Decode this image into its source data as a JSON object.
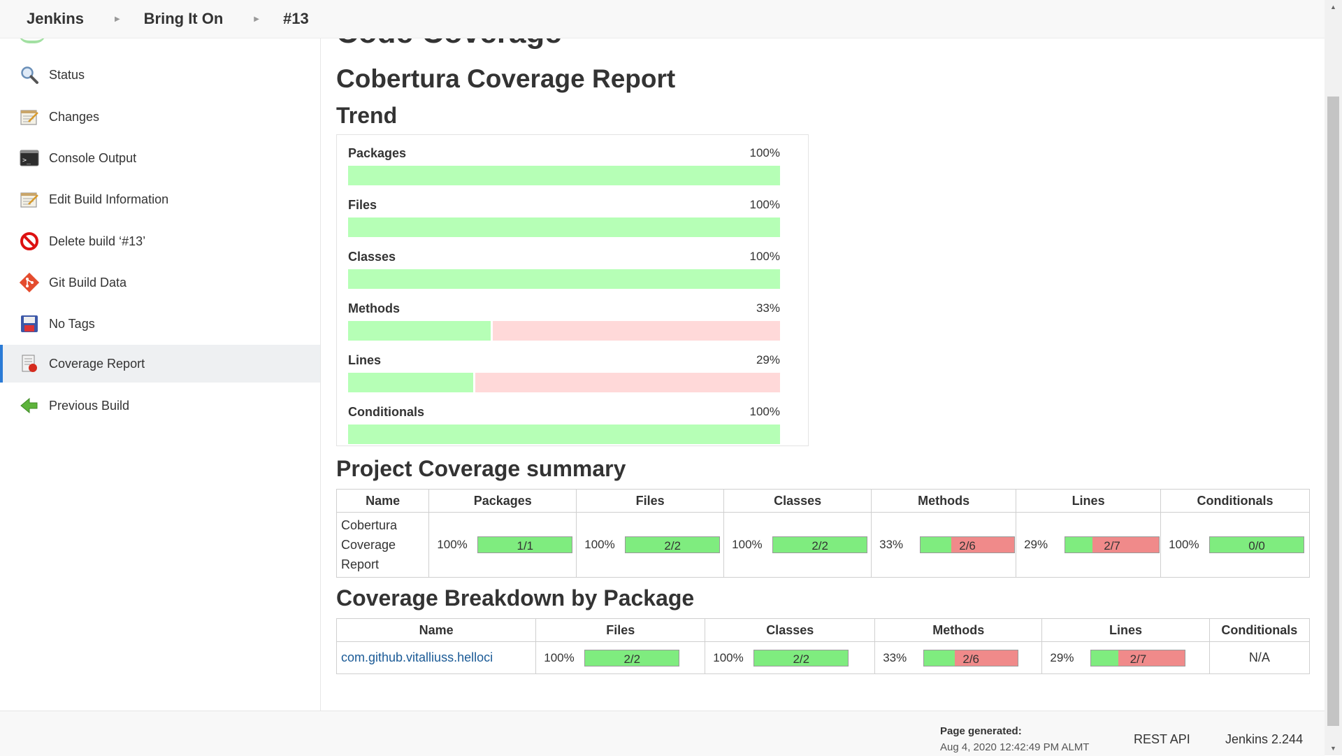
{
  "breadcrumb": [
    "Jenkins",
    "Bring It On",
    "#13"
  ],
  "sidebar": {
    "items": [
      {
        "label": "Status",
        "icon": "magnifier-icon"
      },
      {
        "label": "Changes",
        "icon": "notepad-icon"
      },
      {
        "label": "Console Output",
        "icon": "terminal-icon"
      },
      {
        "label": "Edit Build Information",
        "icon": "notepad-icon"
      },
      {
        "label": "Delete build ‘#13’",
        "icon": "no-entry-icon"
      },
      {
        "label": "Git Build Data",
        "icon": "git-icon"
      },
      {
        "label": "No Tags",
        "icon": "save-icon"
      },
      {
        "label": "Coverage Report",
        "icon": "coverage-report-icon",
        "active": true
      },
      {
        "label": "Previous Build",
        "icon": "arrow-left-icon"
      }
    ]
  },
  "main": {
    "cut_heading": "Code Coverage",
    "report_title": "Cobertura Coverage Report",
    "trend_heading": "Trend",
    "summary_heading": "Project Coverage summary",
    "breakdown_heading": "Coverage Breakdown by Package"
  },
  "trend": [
    {
      "name": "Packages",
      "pct": "100%",
      "value": 100
    },
    {
      "name": "Files",
      "pct": "100%",
      "value": 100
    },
    {
      "name": "Classes",
      "pct": "100%",
      "value": 100
    },
    {
      "name": "Methods",
      "pct": "33%",
      "value": 33
    },
    {
      "name": "Lines",
      "pct": "29%",
      "value": 29
    },
    {
      "name": "Conditionals",
      "pct": "100%",
      "value": 100
    }
  ],
  "summary": {
    "headers": [
      "Name",
      "Packages",
      "Files",
      "Classes",
      "Methods",
      "Lines",
      "Conditionals"
    ],
    "row": {
      "name": "Cobertura Coverage Report",
      "cells": [
        {
          "pct": "100%",
          "ratio": "1/1",
          "value": 100
        },
        {
          "pct": "100%",
          "ratio": "2/2",
          "value": 100
        },
        {
          "pct": "100%",
          "ratio": "2/2",
          "value": 100
        },
        {
          "pct": "33%",
          "ratio": "2/6",
          "value": 33
        },
        {
          "pct": "29%",
          "ratio": "2/7",
          "value": 29
        },
        {
          "pct": "100%",
          "ratio": "0/0",
          "value": 100
        }
      ]
    }
  },
  "breakdown": {
    "headers": [
      "Name",
      "Files",
      "Classes",
      "Methods",
      "Lines",
      "Conditionals"
    ],
    "row": {
      "name": "com.github.vitalliuss.helloci",
      "cells": [
        {
          "pct": "100%",
          "ratio": "2/2",
          "value": 100
        },
        {
          "pct": "100%",
          "ratio": "2/2",
          "value": 100
        },
        {
          "pct": "33%",
          "ratio": "2/6",
          "value": 33
        },
        {
          "pct": "29%",
          "ratio": "2/7",
          "value": 29
        }
      ],
      "conditionals": "N/A"
    }
  },
  "footer": {
    "page_generated_label": "Page generated:",
    "page_generated_value": "Aug 4, 2020 12:42:49 PM ALMT",
    "rest_api": "REST API",
    "version": "Jenkins 2.244"
  },
  "colors": {
    "covered_bar": "#7fec7f",
    "uncovered_bar": "#f08a8a",
    "trend_covered": "#b6ffb6",
    "trend_uncovered": "#ffd9d9",
    "link": "#1a5a96",
    "active_accent": "#2b7bd6"
  }
}
